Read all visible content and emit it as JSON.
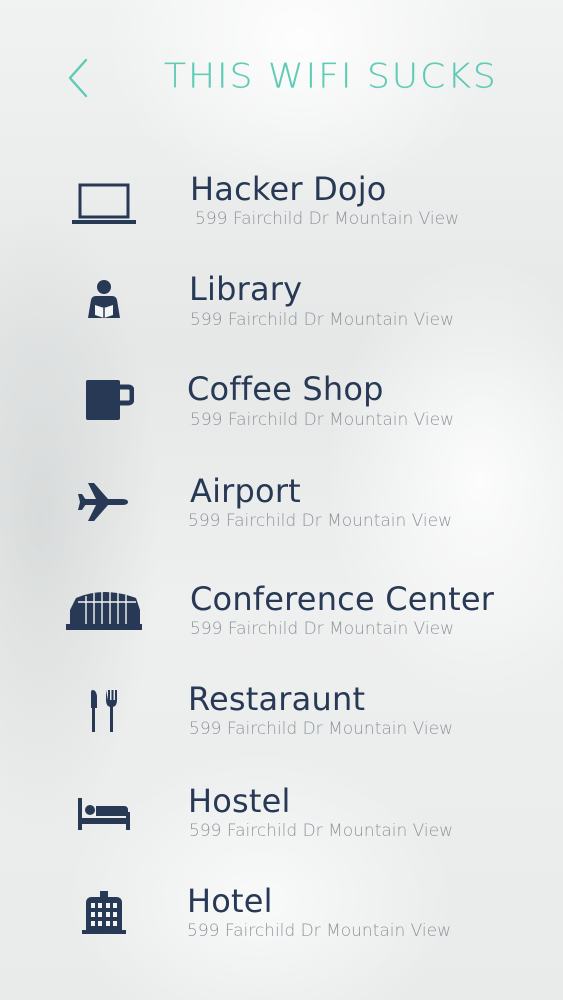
{
  "header": {
    "title": "THIS WIFI SUCKS",
    "back_icon": "chevron-left-icon"
  },
  "colors": {
    "accent": "#5ecbb5",
    "text": "#283955",
    "subtext": "#8d959c"
  },
  "places": [
    {
      "name": "Hacker Dojo",
      "address": "599 Fairchild Dr Mountain View",
      "icon": "laptop-icon"
    },
    {
      "name": "Library",
      "address": "599 Fairchild Dr Mountain View",
      "icon": "reader-icon"
    },
    {
      "name": "Coffee Shop",
      "address": "599 Fairchild Dr Mountain View",
      "icon": "coffee-mug-icon"
    },
    {
      "name": "Airport",
      "address": "599 Fairchild Dr Mountain View",
      "icon": "airplane-icon"
    },
    {
      "name": "Conference Center",
      "address": "599 Fairchild Dr Mountain View",
      "icon": "conference-building-icon"
    },
    {
      "name": "Restaraunt",
      "address": "599 Fairchild Dr Mountain View",
      "icon": "fork-knife-icon"
    },
    {
      "name": "Hostel",
      "address": "599 Fairchild Dr Mountain View",
      "icon": "bed-icon"
    },
    {
      "name": "Hotel",
      "address": "599 Fairchild Dr Mountain View",
      "icon": "hotel-building-icon"
    }
  ]
}
